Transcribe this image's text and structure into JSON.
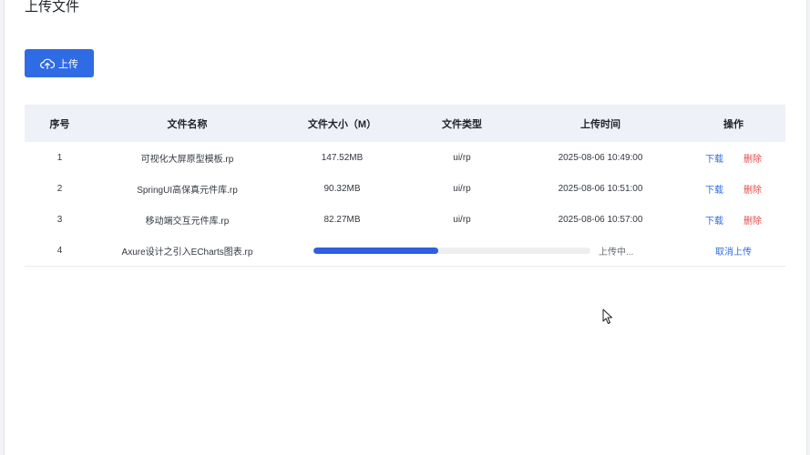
{
  "page": {
    "title": "上传文件",
    "upload_label": "上传"
  },
  "table": {
    "headers": [
      "序号",
      "文件名称",
      "文件大小（M）",
      "文件类型",
      "上传时间",
      "操作"
    ],
    "rows": [
      {
        "index": "1",
        "name": "可视化大屏原型模板.rp",
        "size": "147.52MB",
        "type": "ui/rp",
        "time": "2025-08-06 10:49:00",
        "download": "下载",
        "delete": "删除"
      },
      {
        "index": "2",
        "name": "SpringUI高保真元件库.rp",
        "size": "90.32MB",
        "type": "ui/rp",
        "time": "2025-08-06 10:51:00",
        "download": "下载",
        "delete": "删除"
      },
      {
        "index": "3",
        "name": "移动端交互元件库.rp",
        "size": "82.27MB",
        "type": "ui/rp",
        "time": "2025-08-06 10:57:00",
        "download": "下载",
        "delete": "删除"
      }
    ],
    "uploading": {
      "index": "4",
      "name": "Axure设计之引入ECharts图表.rp",
      "progress": 0.45,
      "status": "上传中...",
      "cancel": "取消上传"
    }
  },
  "colors": {
    "primary": "#2f6be4",
    "danger": "#e24c4c",
    "progress_fill": "#2f5ee0",
    "header_bg": "#eef1f8"
  }
}
